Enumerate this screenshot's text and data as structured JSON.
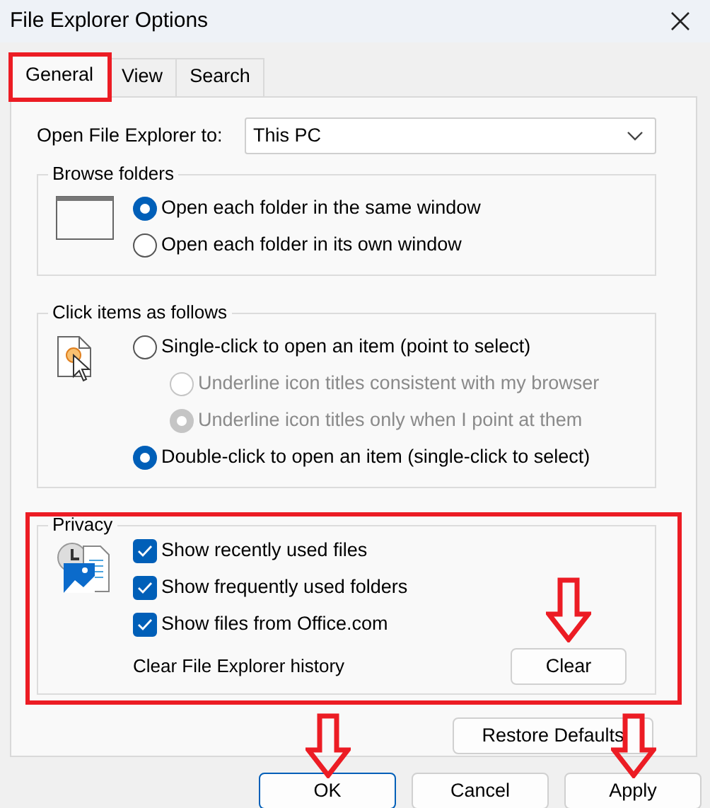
{
  "window": {
    "title": "File Explorer Options"
  },
  "tabs": [
    {
      "label": "General",
      "selected": true,
      "highlighted": true
    },
    {
      "label": "View",
      "selected": false,
      "highlighted": false
    },
    {
      "label": "Search",
      "selected": false,
      "highlighted": false
    }
  ],
  "open_to": {
    "label": "Open File Explorer to:",
    "value": "This PC"
  },
  "browse_folders": {
    "title": "Browse folders",
    "options": [
      {
        "label": "Open each folder in the same window",
        "selected": true,
        "disabled": false,
        "indented": false
      },
      {
        "label": "Open each folder in its own window",
        "selected": false,
        "disabled": false,
        "indented": false
      }
    ]
  },
  "click_items": {
    "title": "Click items as follows",
    "options": [
      {
        "label": "Single-click to open an item (point to select)",
        "selected": false,
        "disabled": false,
        "indented": false
      },
      {
        "label": "Underline icon titles consistent with my browser",
        "selected": false,
        "disabled": true,
        "indented": true
      },
      {
        "label": "Underline icon titles only when I point at them",
        "selected": true,
        "disabled": true,
        "indented": true
      },
      {
        "label": "Double-click to open an item (single-click to select)",
        "selected": true,
        "disabled": false,
        "indented": false
      }
    ]
  },
  "privacy": {
    "title": "Privacy",
    "highlighted": true,
    "checkboxes": [
      {
        "label": "Show recently used files",
        "checked": true
      },
      {
        "label": "Show frequently used folders",
        "checked": true
      },
      {
        "label": "Show files from Office.com",
        "checked": true
      }
    ],
    "clear_label": "Clear File Explorer history",
    "clear_button": {
      "label": "Clear",
      "arrow": true
    }
  },
  "restore_button": {
    "label": "Restore Defaults"
  },
  "buttons": [
    {
      "label": "OK",
      "default": true,
      "arrow": true
    },
    {
      "label": "Cancel",
      "default": false
    },
    {
      "label": "Apply",
      "default": false,
      "arrow": true
    }
  ]
}
